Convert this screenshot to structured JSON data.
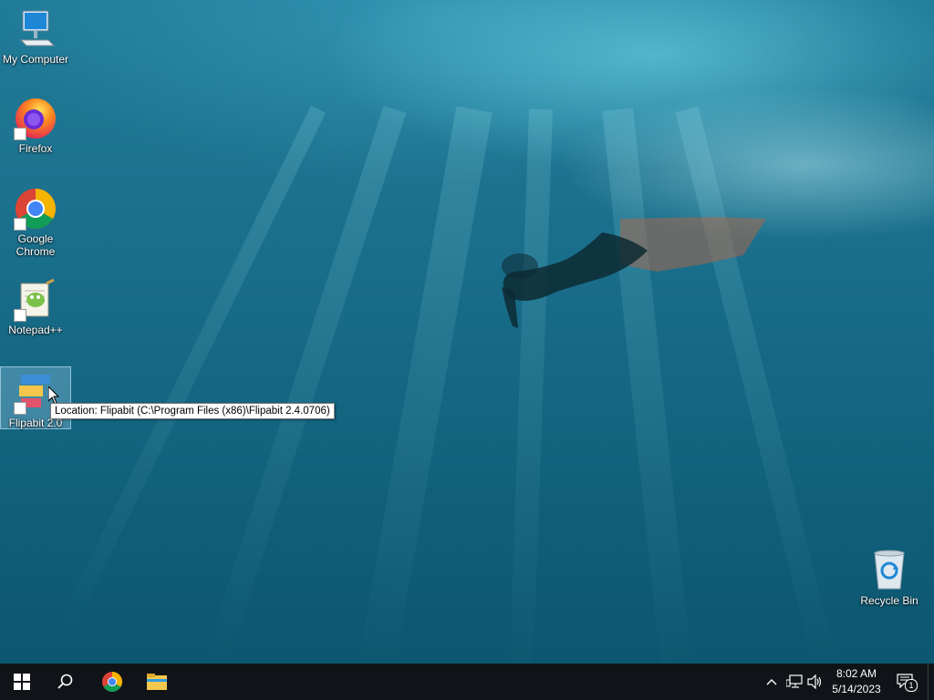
{
  "desktop": {
    "icons": [
      {
        "label": "My Computer"
      },
      {
        "label": "Firefox"
      },
      {
        "label": "Google Chrome"
      },
      {
        "label": "Notepad++"
      },
      {
        "label": "Flipabit 2.0"
      },
      {
        "label": "Recycle Bin"
      }
    ],
    "tooltip": "Location: Flipabit (C:\\Program Files (x86)\\Flipabit 2.4.0706)"
  },
  "taskbar": {
    "pinned": [
      "start-icon",
      "search-icon",
      "chrome-icon",
      "file-explorer-icon"
    ],
    "tray": {
      "time": "8:02 AM",
      "date": "5/14/2023",
      "notification_count": "1"
    }
  },
  "colors": {
    "taskbar": "#101317",
    "accent": "#0078d7"
  }
}
